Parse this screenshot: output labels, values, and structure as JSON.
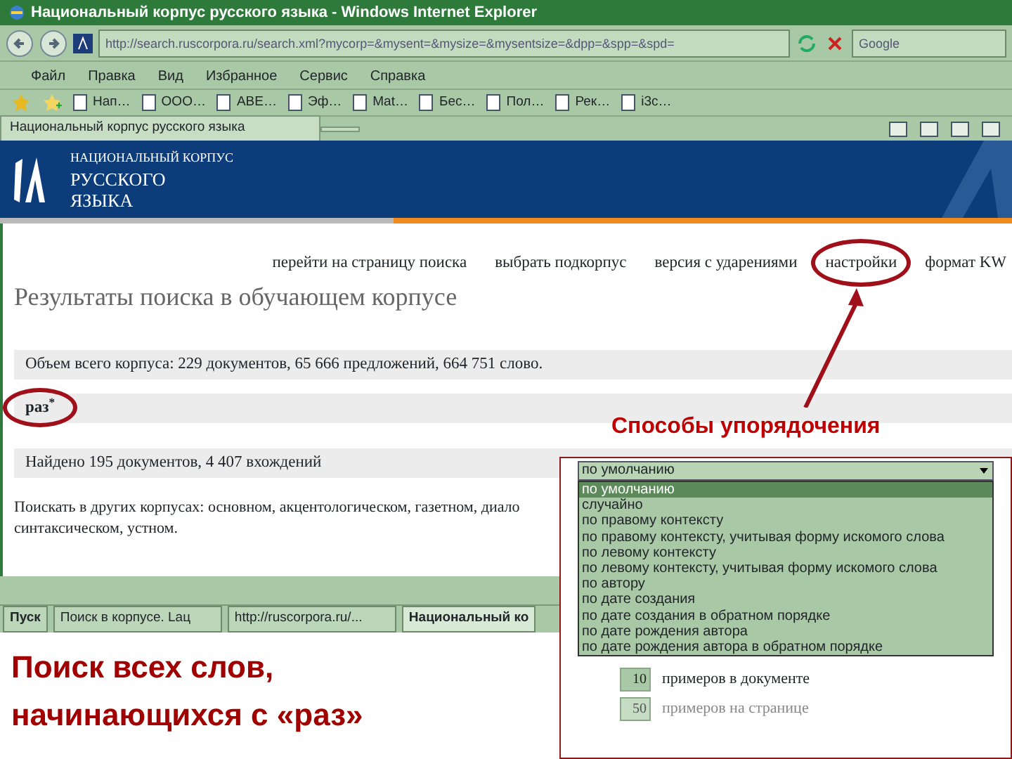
{
  "window": {
    "title": "Национальный корпус русского языка - Windows Internet Explorer"
  },
  "address_bar": {
    "url": "http://search.ruscorpora.ru/search.xml?mycorp=&mysent=&mysize=&mysentsize=&dpp=&spp=&spd="
  },
  "search_box": {
    "value": "Google"
  },
  "menu": [
    "Файл",
    "Правка",
    "Вид",
    "Избранное",
    "Сервис",
    "Справка"
  ],
  "favorites": [
    {
      "label": "Нап…"
    },
    {
      "label": "ООО…"
    },
    {
      "label": "ABE…"
    },
    {
      "label": "Эф…"
    },
    {
      "label": "Mat…"
    },
    {
      "label": "Бес…"
    },
    {
      "label": "Пол…"
    },
    {
      "label": "Рек…"
    },
    {
      "label": "i3c…"
    }
  ],
  "tabs": [
    {
      "label": "Национальный корпус русского языка",
      "selected": true
    }
  ],
  "site": {
    "logo": [
      "НАЦИОНАЛЬНЫЙ КОРПУС",
      "РУССКОГО",
      "ЯЗЫКА"
    ],
    "nav_links": [
      "перейти на страницу поиска",
      "выбрать подкорпус",
      "версия с ударениями",
      "настройки",
      "формат KW"
    ],
    "heading": "Результаты поиска в обучающем корпусе",
    "corpus_stats": "Объем всего корпуса: 229 документов, 65 666 предложений, 664 751 слово.",
    "query": "раз$^{*}$",
    "found": "Найдено 195 документов, 4 407 вхождений",
    "other_corpora": {
      "label": "Поискать в других корпусах: ",
      "lines": [
        [
          {
            "label": "основном",
            "after": ", "
          },
          {
            "label": "акцентологическом",
            "after": ", "
          },
          {
            "label": "газетном",
            "after": ", "
          },
          {
            "label": "диало"
          }
        ],
        [
          {
            "label": "синтаксическом",
            "after": ", "
          },
          {
            "label": "устном",
            "after": "."
          }
        ]
      ]
    }
  },
  "taskbar": {
    "start": "Пуск",
    "items": [
      {
        "label": "Поиск в корпусе. Lац",
        "selected": false
      },
      {
        "label": "http://ruscorpora.ru/...",
        "selected": false
      },
      {
        "label": "Национальный ко",
        "selected": true
      }
    ]
  },
  "annotations": {
    "callout": "Способы упорядочения",
    "caption": [
      "Поиск всех слов,",
      "начинающихся с «раз»"
    ]
  },
  "sort_panel": {
    "value": "по умолчанию",
    "options": [
      {
        "label": "по умолчанию",
        "selected": true
      },
      {
        "label": "случайно",
        "selected": false
      },
      {
        "label": "по правому контексту",
        "selected": false
      },
      {
        "label": "по правому контексту, учитывая форму искомого слова",
        "selected": false
      },
      {
        "label": "по левому контексту",
        "selected": false
      },
      {
        "label": "по левому контексту, учитывая форму искомого слова",
        "selected": false
      },
      {
        "label": "по автору",
        "selected": false
      },
      {
        "label": "по дате создания",
        "selected": false
      },
      {
        "label": "по дате создания в обратном порядке",
        "selected": false
      },
      {
        "label": "по дате рождения автора",
        "selected": false
      },
      {
        "label": "по дате рождения автора в обратном порядке",
        "selected": false
      }
    ],
    "settings": [
      {
        "value": "10",
        "label": "примеров в документе",
        "disabled": false
      },
      {
        "value": "50",
        "label": "примеров на странице",
        "disabled": true
      }
    ]
  }
}
